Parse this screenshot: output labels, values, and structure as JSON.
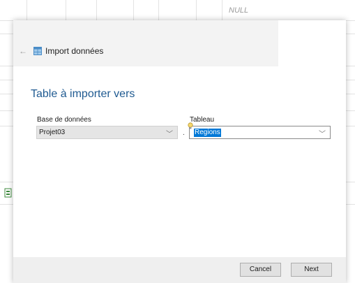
{
  "background": {
    "cell_text": "NULL"
  },
  "dialog": {
    "title": "Import données",
    "section_title": "Table à importer vers",
    "database": {
      "label": "Base de données",
      "value": "Projet03"
    },
    "separator": ".",
    "table": {
      "label": "Tableau",
      "value": "Regions"
    },
    "buttons": {
      "cancel": "Cancel",
      "next": "Next"
    }
  },
  "colors": {
    "accent": "#1f5a91",
    "selection": "#0078d7"
  }
}
